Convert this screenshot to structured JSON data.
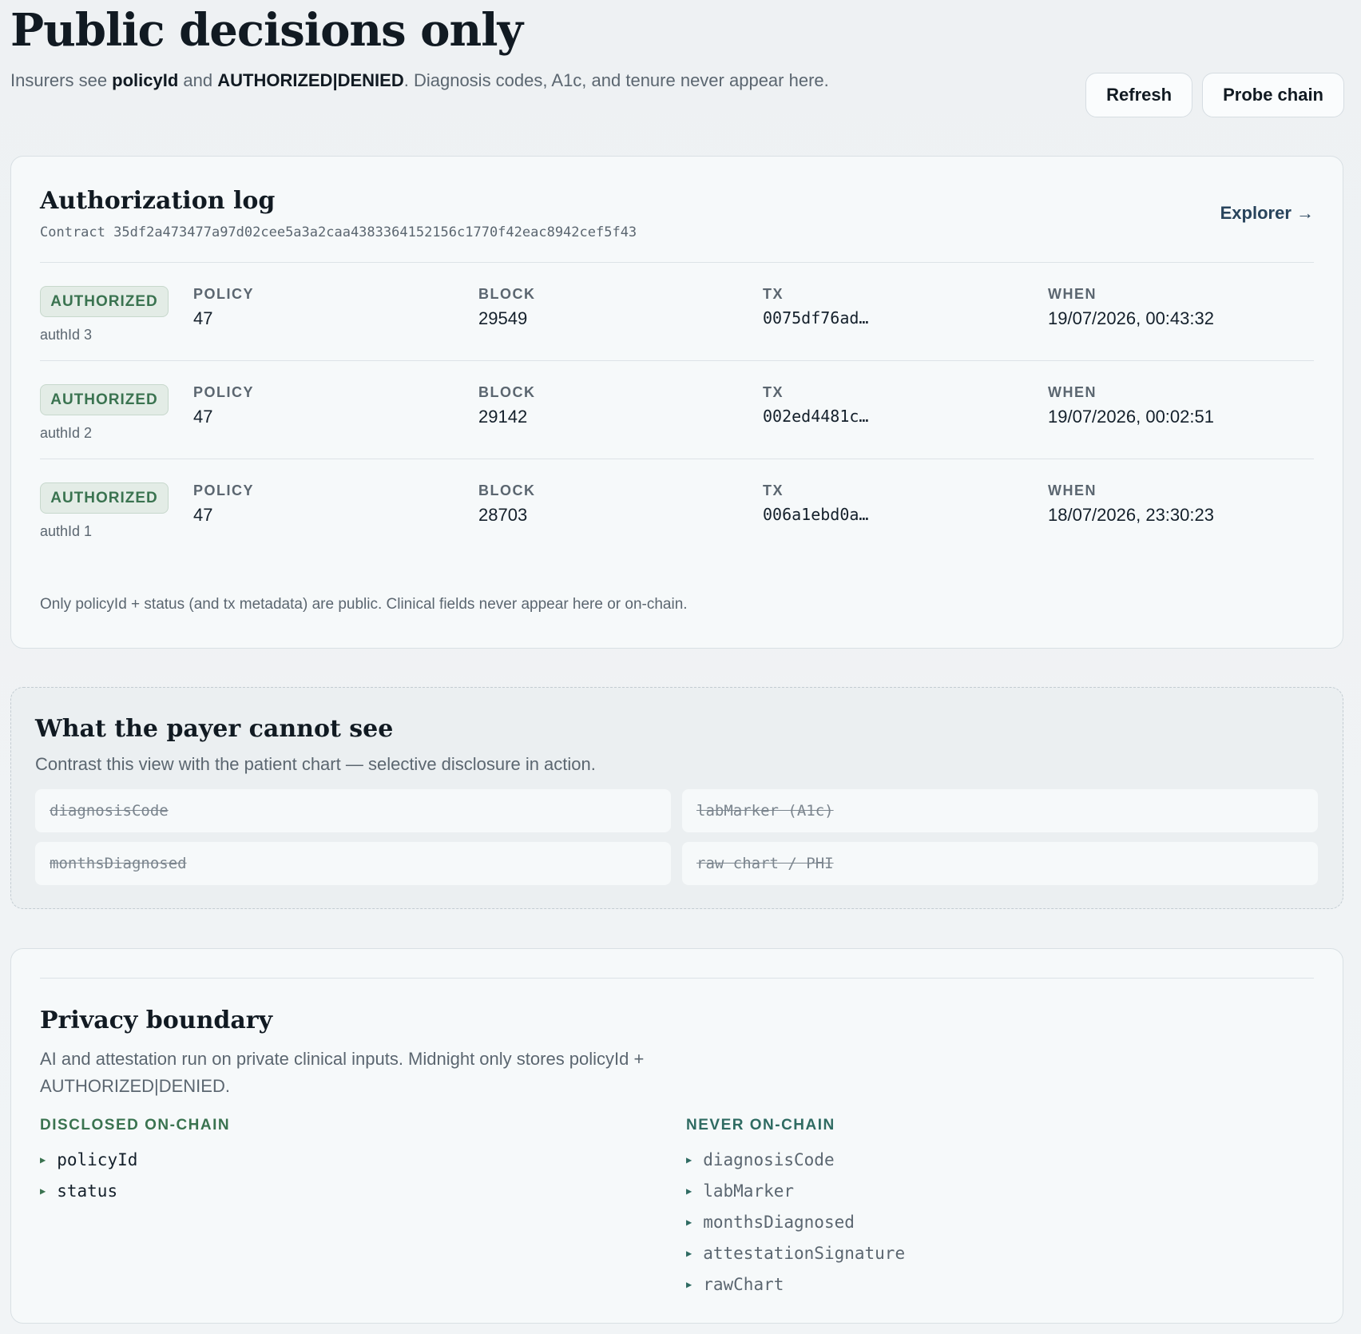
{
  "header": {
    "title": "Public decisions only",
    "subtitle_prefix": "Insurers see ",
    "subtitle_b1": "policyId",
    "subtitle_mid": " and ",
    "subtitle_b2": "AUTHORIZED|DENIED",
    "subtitle_suffix": ". Diagnosis codes, A1c, and tenure never appear here.",
    "refresh_label": "Refresh",
    "probe_label": "Probe chain"
  },
  "auth_log": {
    "title": "Authorization log",
    "contract_label": "Contract",
    "contract_id": "35df2a473477a97d02cee5a3a2caa4383364152156c1770f42eac8942cef5f43",
    "explorer_label": "Explorer →",
    "columns": {
      "policy": "POLICY",
      "block": "BLOCK",
      "tx": "TX",
      "when": "WHEN"
    },
    "rows": [
      {
        "status": "AUTHORIZED",
        "auth_id": "authId 3",
        "policy": "47",
        "block": "29549",
        "tx": "0075df76ad…",
        "when": "19/07/2026, 00:43:32"
      },
      {
        "status": "AUTHORIZED",
        "auth_id": "authId 2",
        "policy": "47",
        "block": "29142",
        "tx": "002ed4481c…",
        "when": "19/07/2026, 00:02:51"
      },
      {
        "status": "AUTHORIZED",
        "auth_id": "authId 1",
        "policy": "47",
        "block": "28703",
        "tx": "006a1ebd0a…",
        "when": "18/07/2026, 23:30:23"
      }
    ],
    "footnote": "Only policyId + status (and tx metadata) are public. Clinical fields never appear here or on-chain."
  },
  "hidden": {
    "title": "What the payer cannot see",
    "subtitle": "Contrast this view with the patient chart — selective disclosure in action.",
    "fields": [
      "diagnosisCode",
      "labMarker (A1c)",
      "monthsDiagnosed",
      "raw chart / PHI"
    ]
  },
  "privacy": {
    "title": "Privacy boundary",
    "subtitle": "AI and attestation run on private clinical inputs. Midnight only stores policyId + AUTHORIZED|DENIED.",
    "disclosed_label": "DISCLOSED ON-CHAIN",
    "disclosed": [
      "policyId",
      "status"
    ],
    "never_label": "NEVER ON-CHAIN",
    "never": [
      "diagnosisCode",
      "labMarker",
      "monthsDiagnosed",
      "attestationSignature",
      "rawChart"
    ]
  },
  "colors": {
    "authorized_green": "#3a7350",
    "link_blue": "#28445c",
    "text_muted": "#5b6670"
  }
}
